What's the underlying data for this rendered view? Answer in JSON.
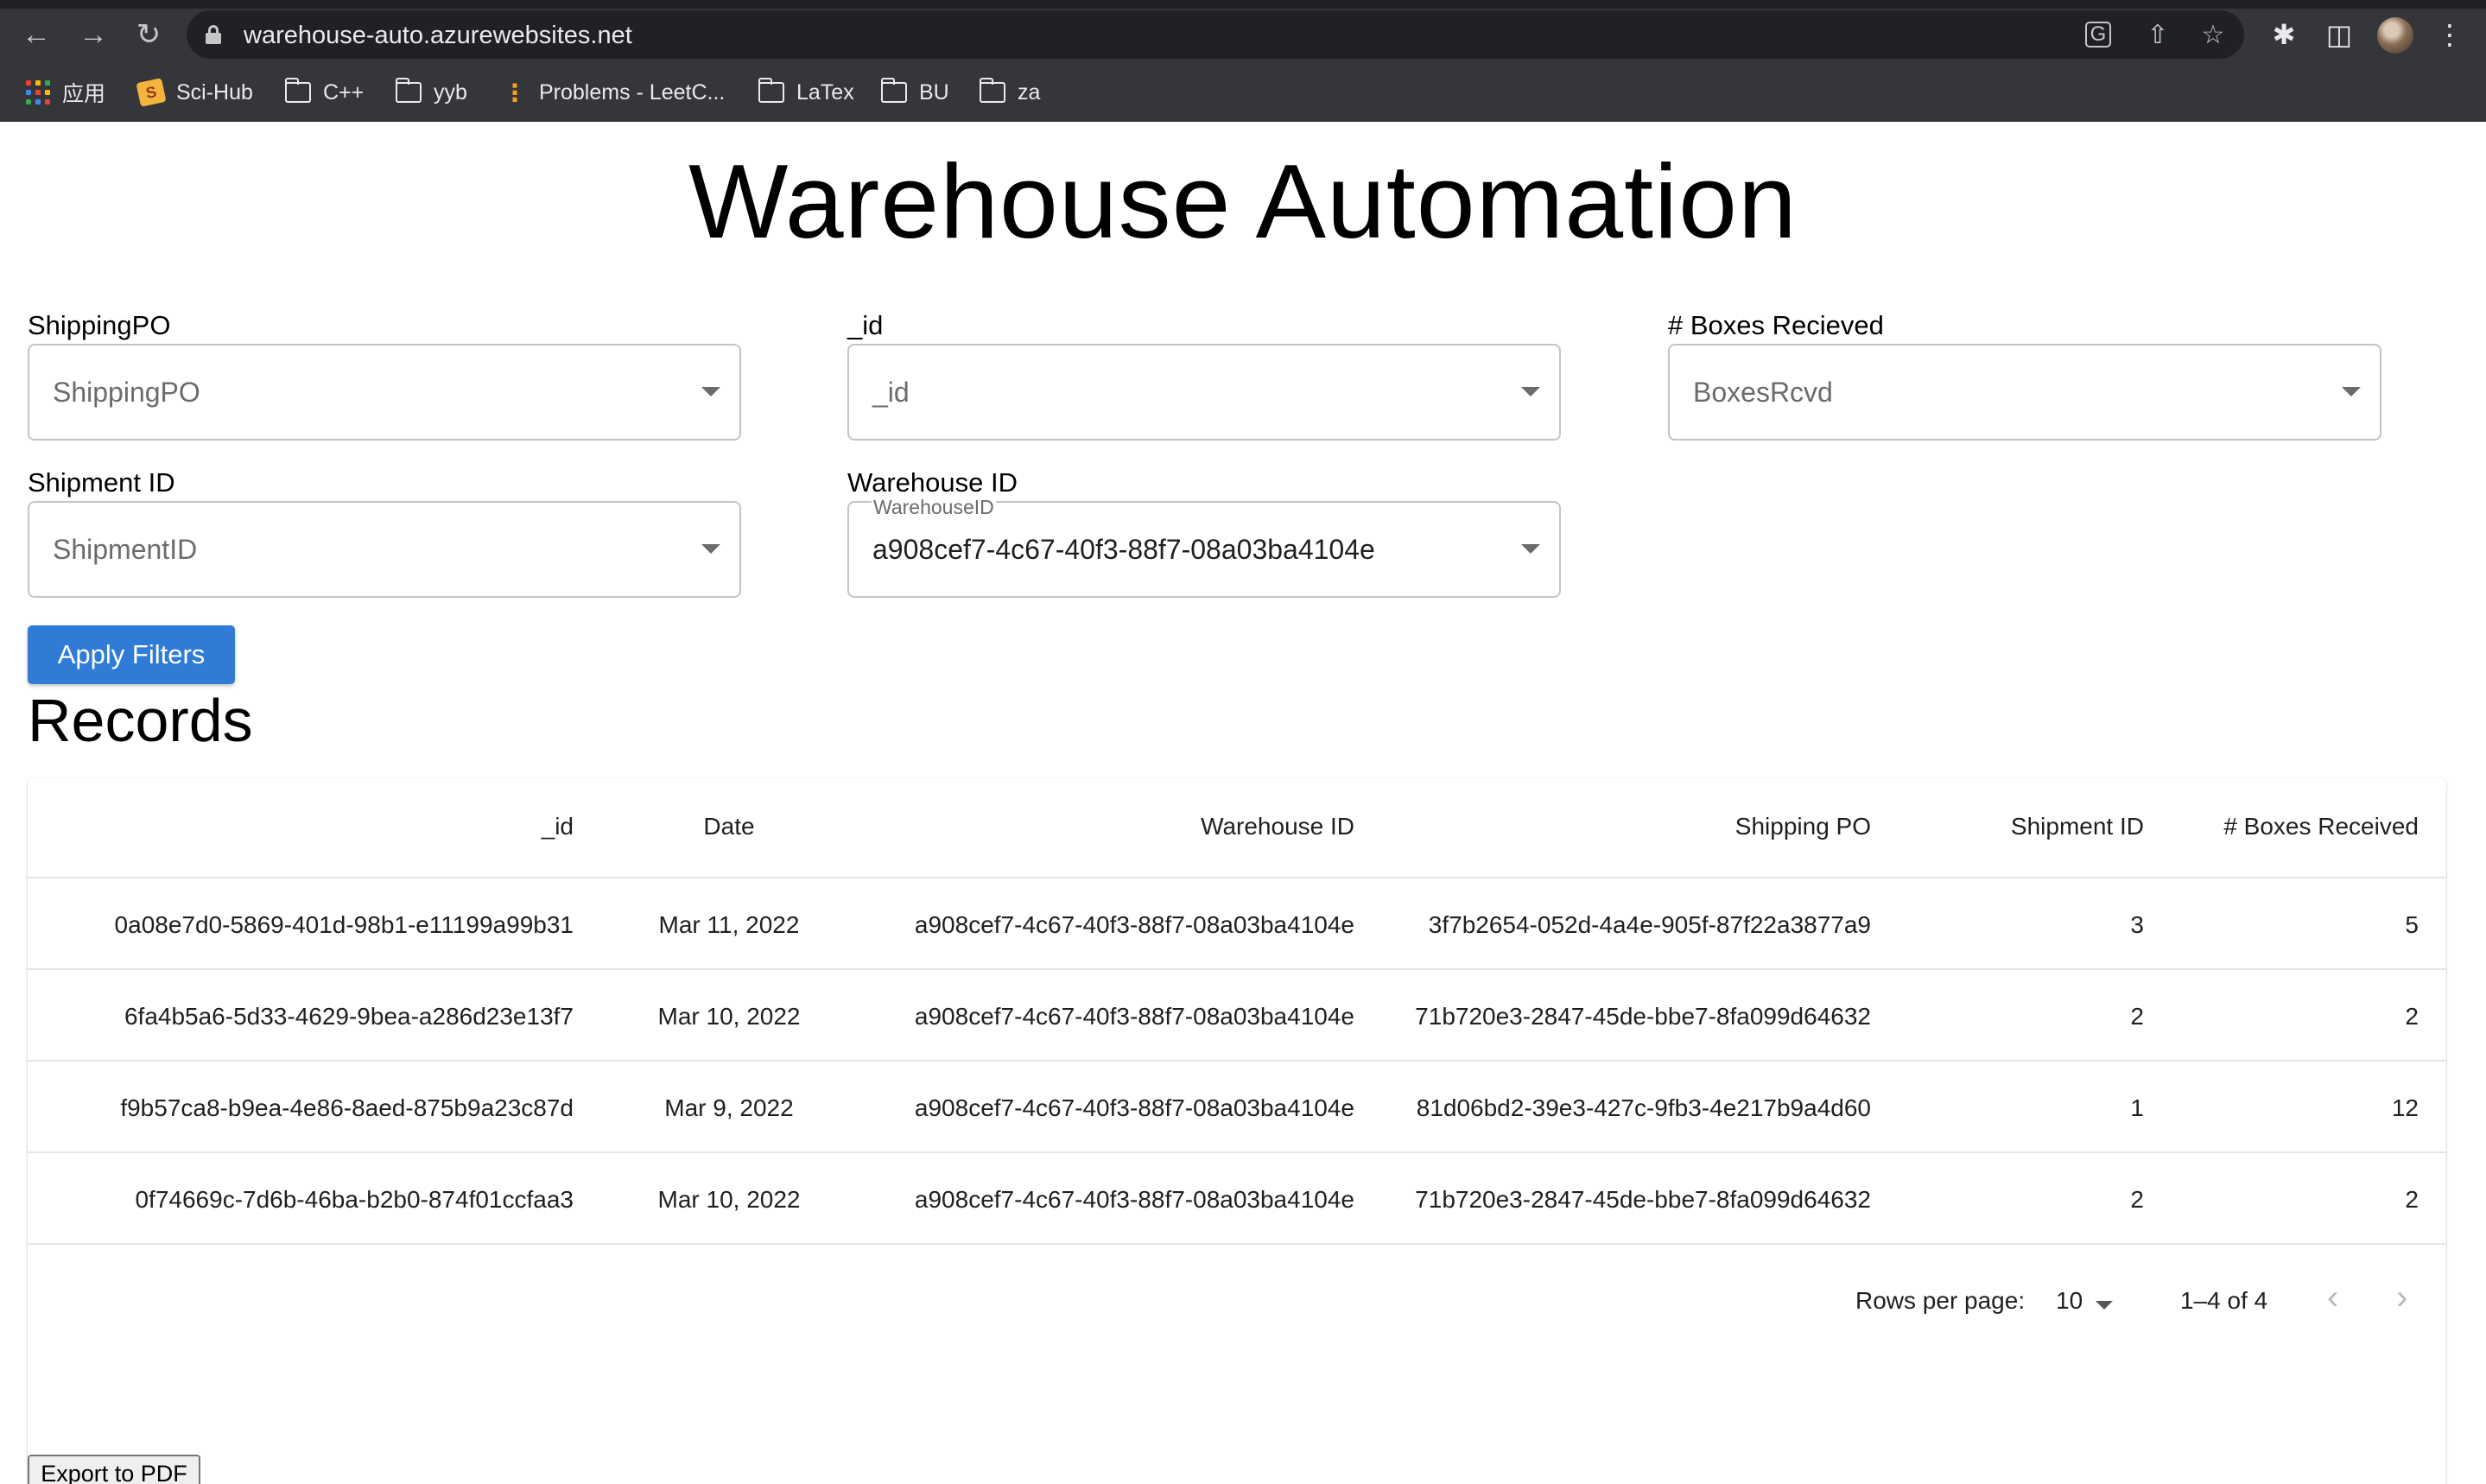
{
  "browser": {
    "url": "warehouse-auto.azurewebsites.net",
    "bookmarks": [
      {
        "label": "应用",
        "icon": "apps-grid-icon"
      },
      {
        "label": "Sci-Hub",
        "icon": "scihub-icon"
      },
      {
        "label": "C++",
        "icon": "folder-icon"
      },
      {
        "label": "yyb",
        "icon": "folder-icon"
      },
      {
        "label": "Problems - LeetC...",
        "icon": "leetcode-icon"
      },
      {
        "label": "LaTex",
        "icon": "folder-icon"
      },
      {
        "label": "BU",
        "icon": "folder-icon"
      },
      {
        "label": "za",
        "icon": "folder-icon"
      }
    ]
  },
  "page": {
    "title": "Warehouse Automation"
  },
  "filters": {
    "shipping_po": {
      "label": "ShippingPO",
      "placeholder": "ShippingPO"
    },
    "id": {
      "label": "_id",
      "placeholder": "_id"
    },
    "boxes": {
      "label": "# Boxes Recieved",
      "placeholder": "BoxesRcvd"
    },
    "shipment_id": {
      "label": "Shipment ID",
      "placeholder": "ShipmentID"
    },
    "warehouse_id": {
      "label": "Warehouse ID",
      "floating_label": "WarehouseID",
      "value": "a908cef7-4c67-40f3-88f7-08a03ba4104e"
    },
    "apply_label": "Apply Filters"
  },
  "records": {
    "heading": "Records",
    "columns": {
      "id": "_id",
      "date": "Date",
      "warehouse_id": "Warehouse ID",
      "shipping_po": "Shipping PO",
      "shipment_id": "Shipment ID",
      "boxes": "# Boxes Received"
    },
    "rows": [
      {
        "id": "0a08e7d0-5869-401d-98b1-e11199a99b31",
        "date": "Mar 11, 2022",
        "warehouse_id": "a908cef7-4c67-40f3-88f7-08a03ba4104e",
        "shipping_po": "3f7b2654-052d-4a4e-905f-87f22a3877a9",
        "shipment_id": "3",
        "boxes": "5"
      },
      {
        "id": "6fa4b5a6-5d33-4629-9bea-a286d23e13f7",
        "date": "Mar 10, 2022",
        "warehouse_id": "a908cef7-4c67-40f3-88f7-08a03ba4104e",
        "shipping_po": "71b720e3-2847-45de-bbe7-8fa099d64632",
        "shipment_id": "2",
        "boxes": "2"
      },
      {
        "id": "f9b57ca8-b9ea-4e86-8aed-875b9a23c87d",
        "date": "Mar 9, 2022",
        "warehouse_id": "a908cef7-4c67-40f3-88f7-08a03ba4104e",
        "shipping_po": "81d06bd2-39e3-427c-9fb3-4e217b9a4d60",
        "shipment_id": "1",
        "boxes": "12"
      },
      {
        "id": "0f74669c-7d6b-46ba-b2b0-874f01ccfaa3",
        "date": "Mar 10, 2022",
        "warehouse_id": "a908cef7-4c67-40f3-88f7-08a03ba4104e",
        "shipping_po": "71b720e3-2847-45de-bbe7-8fa099d64632",
        "shipment_id": "2",
        "boxes": "2"
      }
    ],
    "pagination": {
      "rows_per_page_label": "Rows per page:",
      "rows_per_page_value": "10",
      "range": "1–4 of 4"
    },
    "export_label": "Export to PDF"
  },
  "colors": {
    "primary": "#2f7bd6",
    "chrome_bg": "#35363a",
    "omnibox_bg": "#202124"
  }
}
